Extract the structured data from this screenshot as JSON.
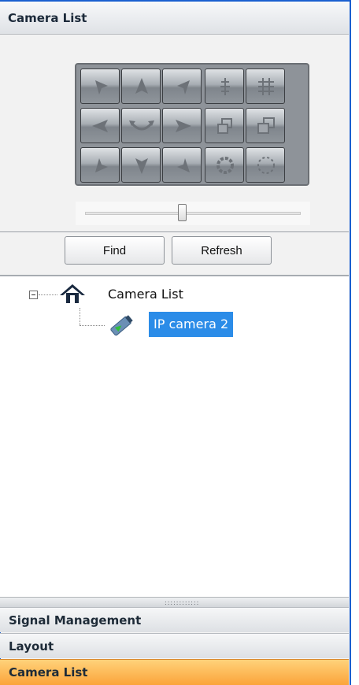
{
  "panel": {
    "title": "Camera List"
  },
  "ptz": {
    "icons": [
      "pan-up-left-icon",
      "tilt-up-icon",
      "pan-up-right-icon",
      "focus-near-icon",
      "focus-far-icon",
      "pan-left-icon",
      "auto-pan-icon",
      "pan-right-icon",
      "zoom-in-icon",
      "zoom-out-icon",
      "pan-down-left-icon",
      "tilt-down-icon",
      "pan-down-right-icon",
      "iris-open-icon",
      "iris-close-icon"
    ],
    "speed_slider_level": 0.45
  },
  "buttons": {
    "find": "Find",
    "refresh": "Refresh"
  },
  "tree": {
    "root": {
      "label": "Camera List",
      "icon": "home-icon",
      "expanded": true
    },
    "items": [
      {
        "label": "IP camera 2",
        "icon": "ip-camera-icon",
        "selected": true
      }
    ]
  },
  "nav": {
    "items": [
      {
        "label": "Signal Management",
        "active": false
      },
      {
        "label": "Layout",
        "active": false
      },
      {
        "label": "Camera List",
        "active": true
      }
    ]
  },
  "colors": {
    "frame_border": "#1a5fd0",
    "selection": "#2b8ce8",
    "active_tab": "#fba43a"
  }
}
